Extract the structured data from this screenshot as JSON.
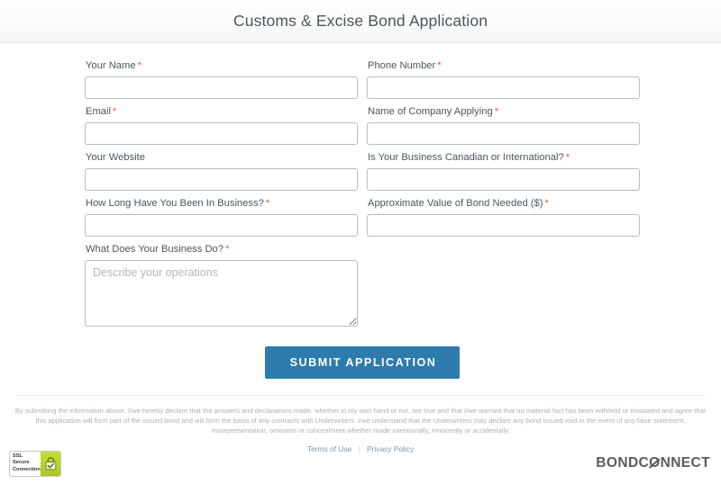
{
  "header": {
    "title": "Customs & Excise Bond Application"
  },
  "form": {
    "required_marker": "*",
    "fields": [
      {
        "label": "Your Name",
        "required": true,
        "value": "",
        "placeholder": "",
        "type": "text"
      },
      {
        "label": "Phone Number",
        "required": true,
        "value": "",
        "placeholder": "",
        "type": "text"
      },
      {
        "label": "Email",
        "required": true,
        "value": "",
        "placeholder": "",
        "type": "text"
      },
      {
        "label": "Name of Company Applying",
        "required": true,
        "value": "",
        "placeholder": "",
        "type": "text"
      },
      {
        "label": "Your Website",
        "required": false,
        "value": "",
        "placeholder": "",
        "type": "text"
      },
      {
        "label": "Is Your Business Canadian or International?",
        "required": true,
        "value": "",
        "placeholder": "",
        "type": "text"
      },
      {
        "label": "How Long Have You Been In Business?",
        "required": true,
        "value": "",
        "placeholder": "",
        "type": "text"
      },
      {
        "label": "Approximate Value of Bond Needed ($)",
        "required": true,
        "value": "",
        "placeholder": "",
        "type": "text"
      }
    ],
    "textarea": {
      "label": "What Does Your Business Do?",
      "required": true,
      "value": "",
      "placeholder": "Describe your operations"
    },
    "submit_label": "SUBMIT APPLICATION"
  },
  "disclaimer": "By submitting the information above, I/we hereby declare that the answers and declarations made, whether in my own hand or not, are true and that I/we warrant that no material fact has been withheld or misstated and agree that this application will form part of the issued bond and will form the basis of any contracts with Underwriters. I/we understand that the Underwriters may declare any bond issued void in the event of any false statement, misrepresentation, omission or concealment whether made intentionally, innocently or accidentally.",
  "legal": {
    "terms_label": "Terms of Use",
    "separator": "|",
    "privacy_label": "Privacy Policy"
  },
  "footer": {
    "ssl_badge": {
      "line1": "SSL",
      "line2": "Secure",
      "line3": "Connection",
      "icon": "padlock-icon"
    },
    "logo": {
      "part1": "BONDC",
      "part_o": "O",
      "part2": "NNECT"
    }
  },
  "colors": {
    "accent_button": "#2e7bae",
    "required_asterisk": "#f4512c",
    "label_text": "#4a5562",
    "title_text": "#4c5663",
    "link_text": "#7e93b0",
    "disclaimer_text": "#a9b0bb",
    "input_border": "#b9bcbf",
    "ssl_green": "#c9dd3a"
  }
}
